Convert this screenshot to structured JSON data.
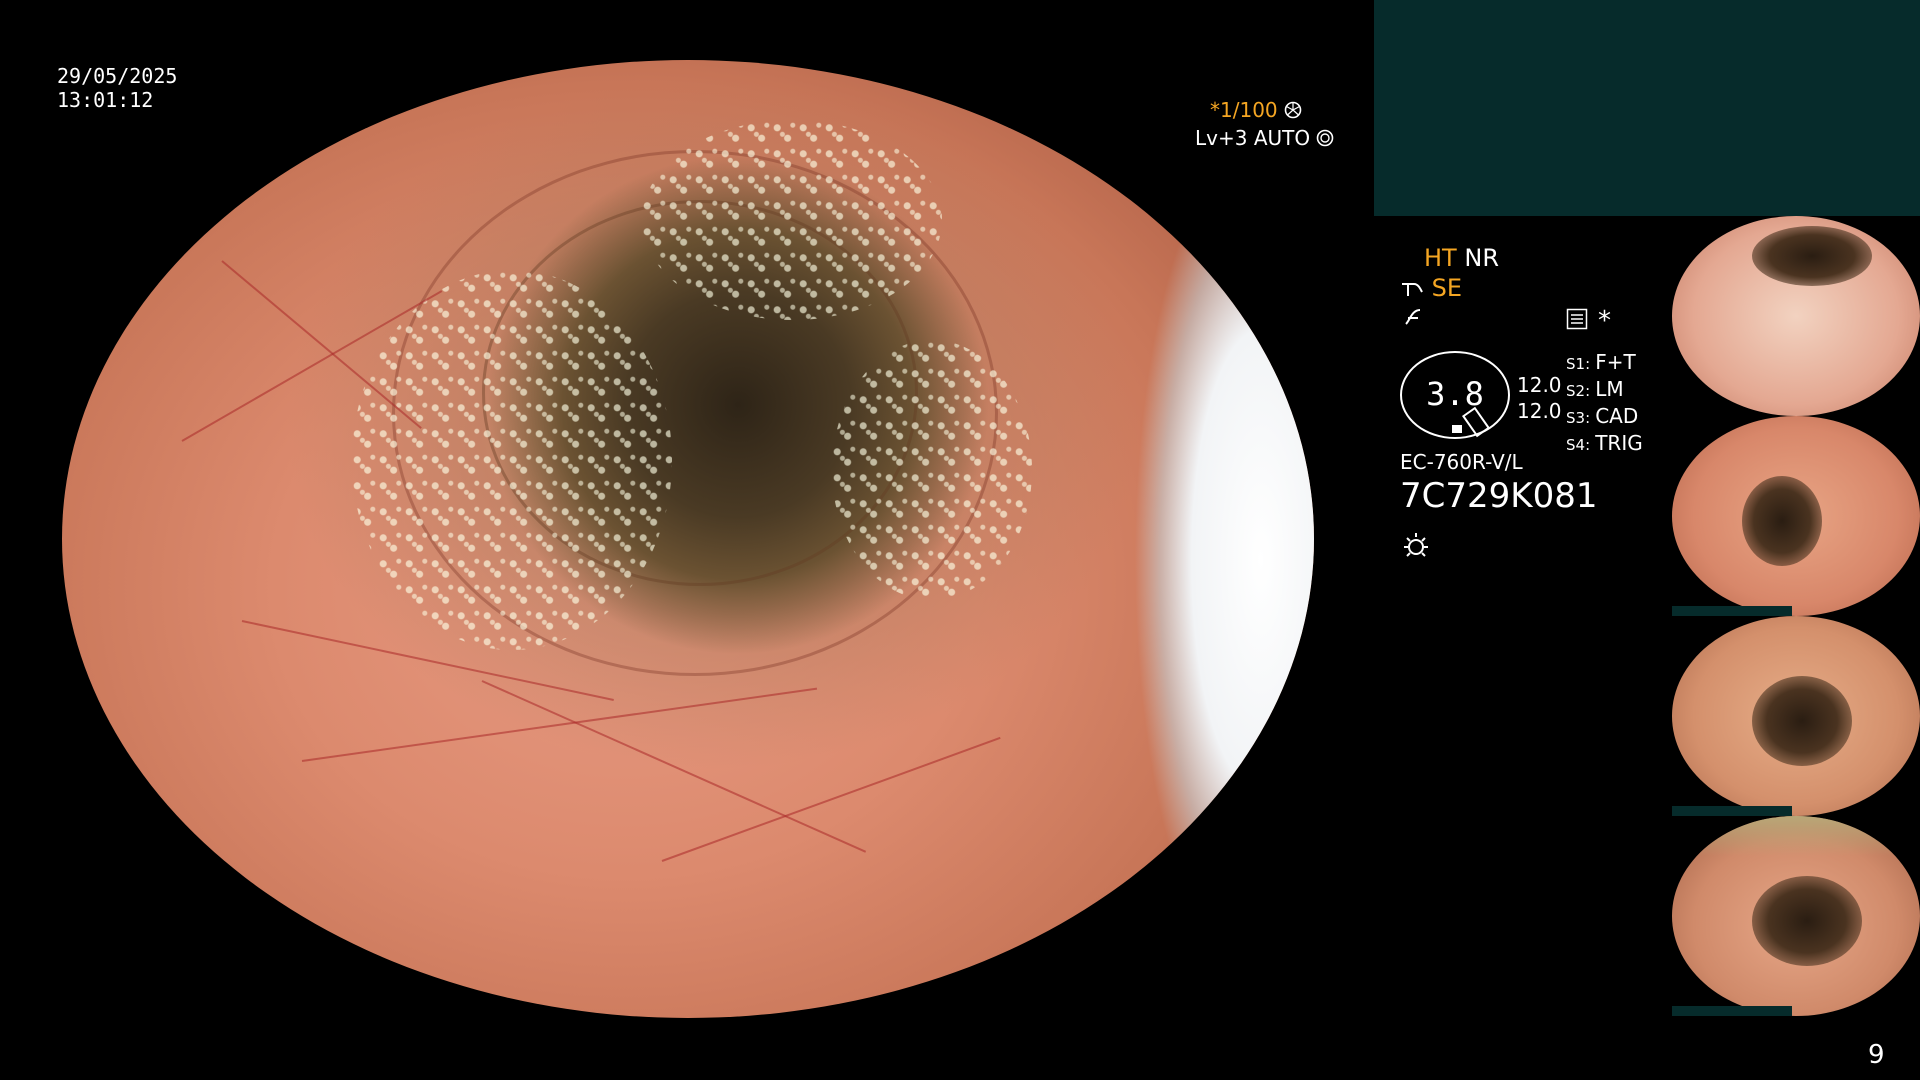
{
  "timestamp": {
    "date": "29/05/2025",
    "time": "13:01:12"
  },
  "shutter": {
    "value": "*1/100",
    "icon": "shutter-icon"
  },
  "iris": {
    "value": "Lv+3 AUTO",
    "icon": "iris-icon"
  },
  "image_settings": {
    "ht_label": "HT",
    "nr_label": "NR",
    "se_label": "SE",
    "asterisk": "*"
  },
  "magnification": {
    "value": "3.8",
    "focal_a": "12.0",
    "focal_b": "12.0"
  },
  "switches": [
    {
      "key": "S1:",
      "value": "F+T"
    },
    {
      "key": "S2:",
      "value": "LM"
    },
    {
      "key": "S3:",
      "value": "CAD"
    },
    {
      "key": "S4:",
      "value": "TRIG"
    }
  ],
  "scope": {
    "model": "EC-760R-V/L",
    "serial": "7C729K081"
  },
  "page_number": "9",
  "colors": {
    "accent_orange": "#f5a623",
    "panel_teal": "#062b2b",
    "text_white": "#ffffff"
  }
}
